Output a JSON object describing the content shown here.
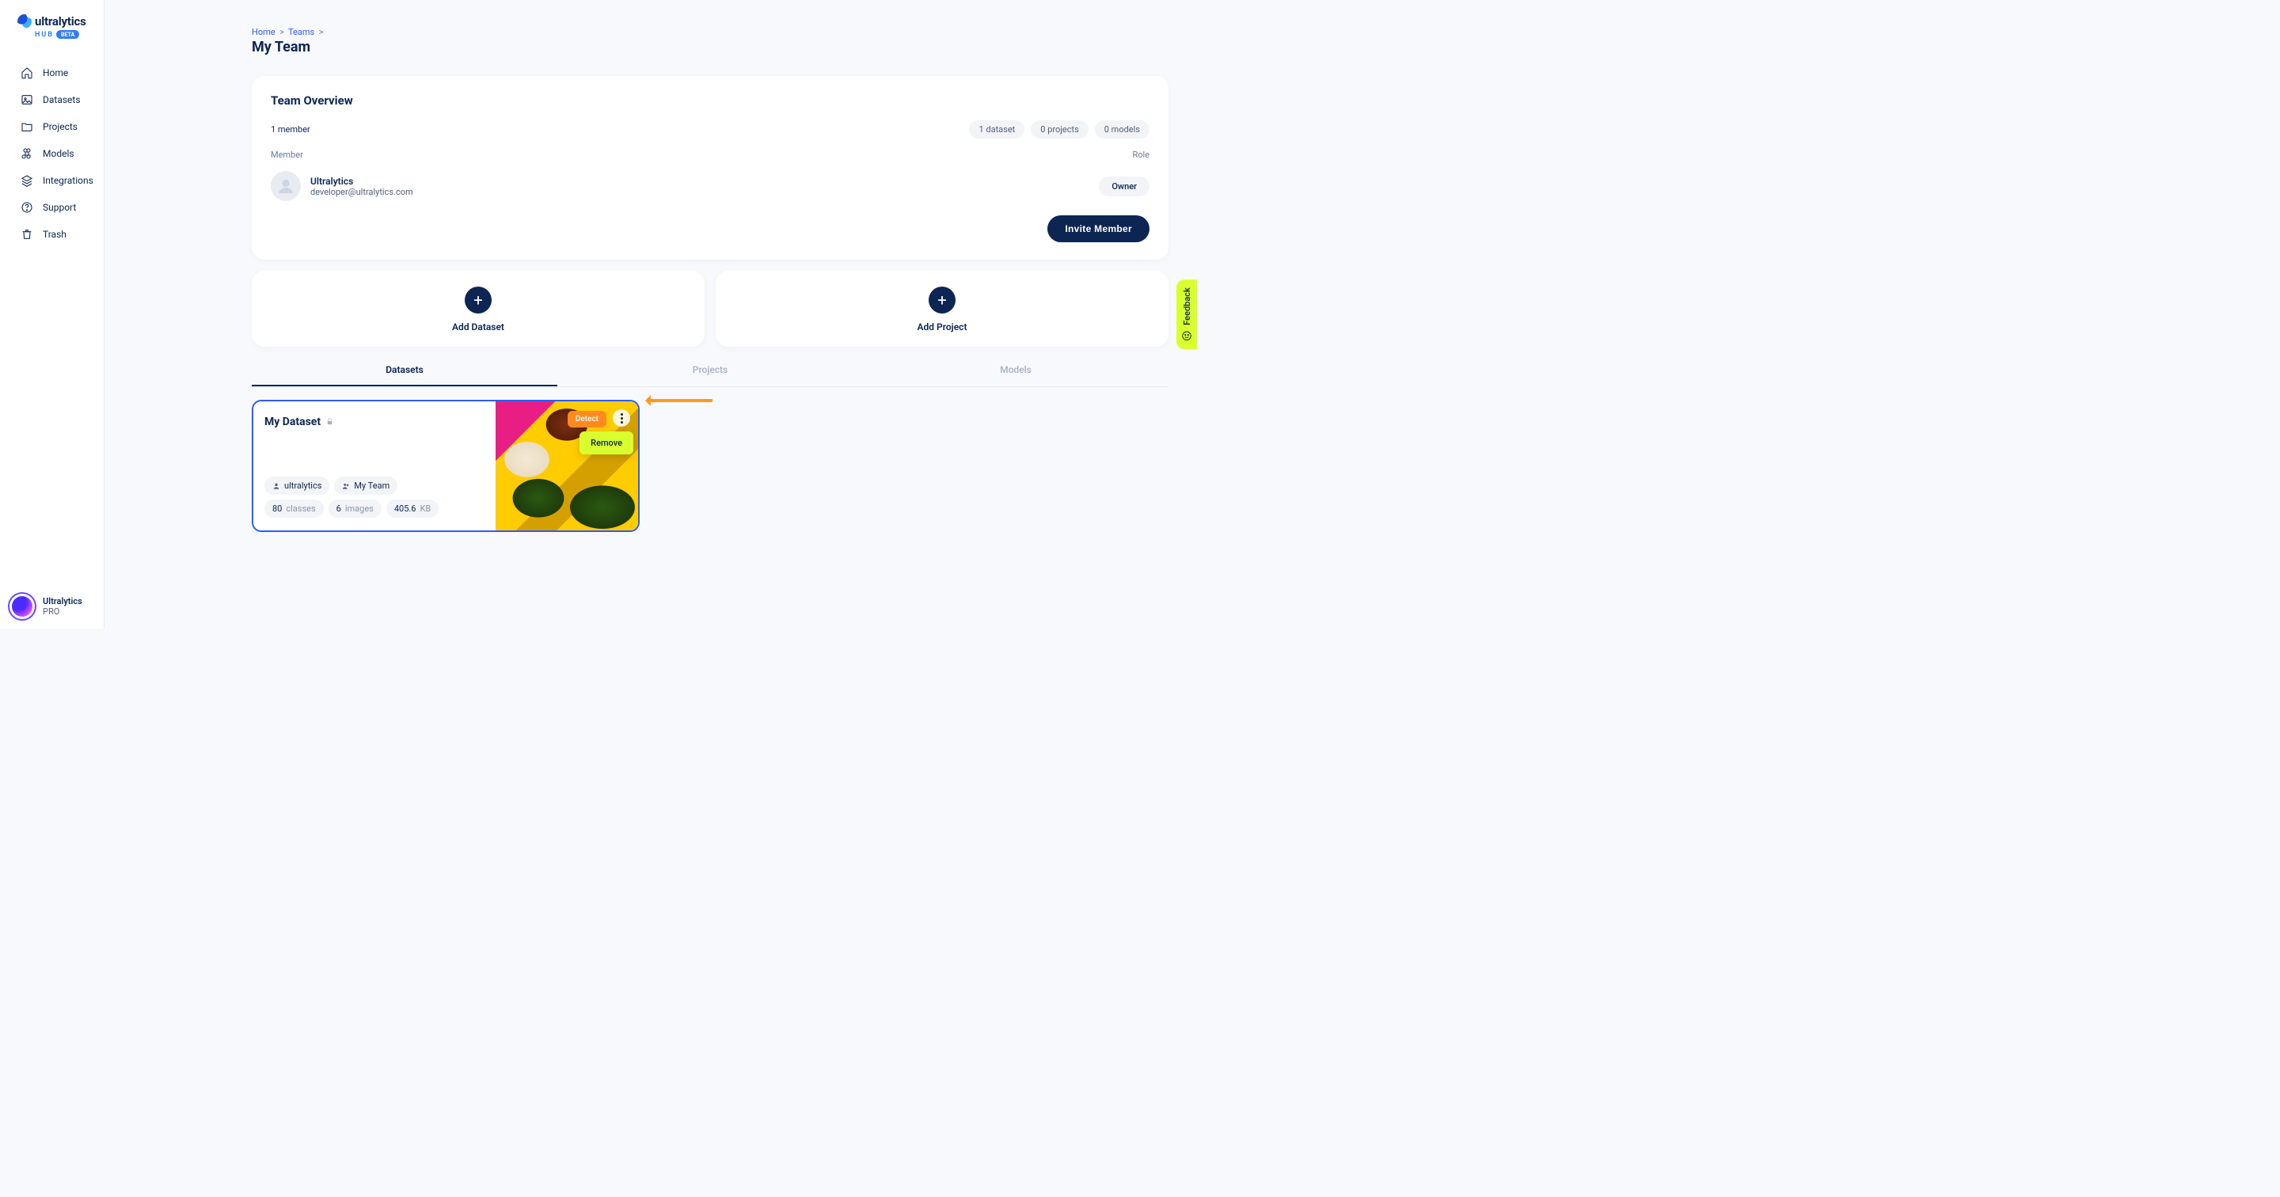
{
  "brand": {
    "name": "ultralytics",
    "hub": "HUB",
    "beta": "BETA"
  },
  "nav": {
    "home": "Home",
    "datasets": "Datasets",
    "projects": "Projects",
    "models": "Models",
    "integrations": "Integrations",
    "support": "Support",
    "trash": "Trash"
  },
  "sidebar_user": {
    "name": "Ultralytics",
    "plan": "PRO"
  },
  "breadcrumbs": {
    "home": "Home",
    "teams": "Teams"
  },
  "page_title": "My Team",
  "overview": {
    "title": "Team Overview",
    "member_count": "1 member",
    "stats": {
      "datasets": "1 dataset",
      "projects": "0 projects",
      "models": "0 models"
    },
    "th_member": "Member",
    "th_role": "Role",
    "member": {
      "name": "Ultralytics",
      "email": "developer@ultralytics.com",
      "role": "Owner"
    },
    "invite": "Invite Member"
  },
  "add": {
    "dataset": "Add Dataset",
    "project": "Add Project"
  },
  "tabs": {
    "datasets": "Datasets",
    "projects": "Projects",
    "models": "Models"
  },
  "dataset": {
    "title": "My Dataset",
    "owner": "ultralytics",
    "team": "My Team",
    "classes_n": "80",
    "classes_l": "classes",
    "images_n": "6",
    "images_l": "images",
    "size_n": "405.6",
    "size_u": "KB",
    "detect": "Detect",
    "menu_remove": "Remove"
  },
  "feedback": "Feedback"
}
